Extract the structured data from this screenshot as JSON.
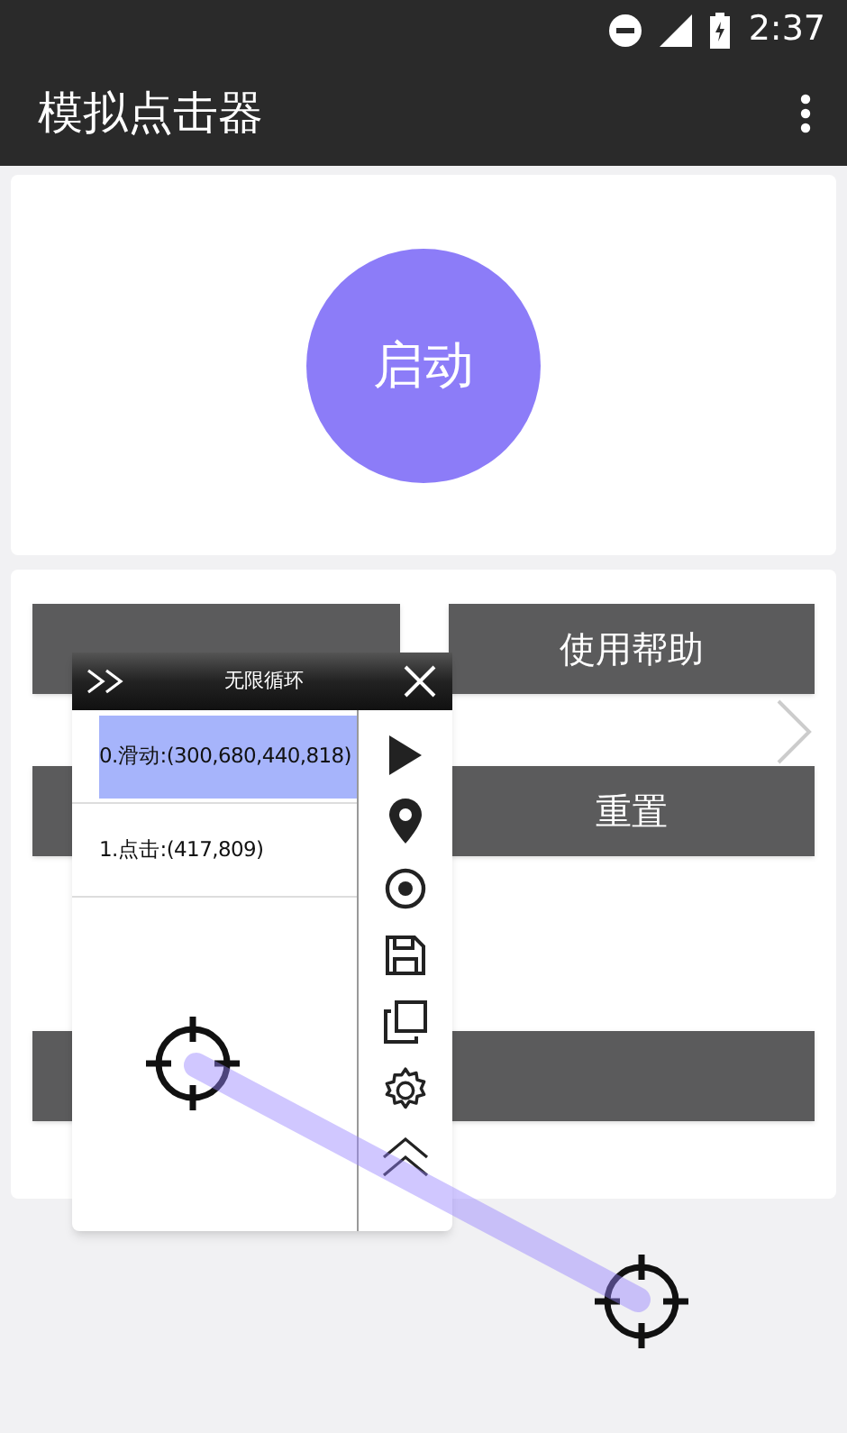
{
  "status_bar": {
    "time": "2:37"
  },
  "app_bar": {
    "title": "模拟点击器"
  },
  "start_button": {
    "label": "启动"
  },
  "buttons": [
    {
      "label": "使用帮助"
    },
    {
      "label": "重置"
    }
  ],
  "floating_panel": {
    "title": "无限循环",
    "steps": [
      {
        "label": "0.滑动:(300,680,440,818)",
        "selected": true
      },
      {
        "label": "1.点击:(417,809)",
        "selected": false
      }
    ]
  }
}
